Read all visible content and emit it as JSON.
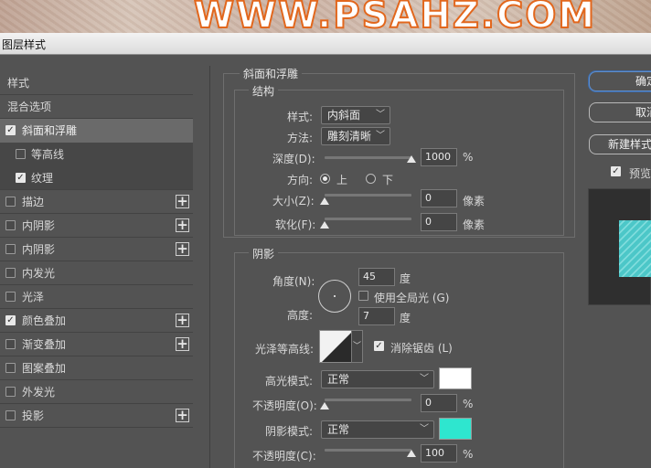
{
  "banner": {
    "text": "WWW.PSAHZ.COM"
  },
  "window": {
    "title": "图层样式"
  },
  "sidebar": {
    "items": [
      {
        "label": "样式"
      },
      {
        "label": "混合选项"
      },
      {
        "label": "斜面和浮雕",
        "checked": true,
        "selected": true
      },
      {
        "label": "等高线",
        "checked": false
      },
      {
        "label": "纹理",
        "checked": true
      },
      {
        "label": "描边",
        "checked": false,
        "plus": true
      },
      {
        "label": "内阴影",
        "checked": false,
        "plus": true
      },
      {
        "label": "内阴影",
        "checked": false,
        "plus": true
      },
      {
        "label": "内发光",
        "checked": false
      },
      {
        "label": "光泽",
        "checked": false
      },
      {
        "label": "颜色叠加",
        "checked": true,
        "plus": true
      },
      {
        "label": "渐变叠加",
        "checked": false,
        "plus": true
      },
      {
        "label": "图案叠加",
        "checked": false
      },
      {
        "label": "外发光",
        "checked": false
      },
      {
        "label": "投影",
        "checked": false,
        "plus": true
      }
    ]
  },
  "bevel": {
    "section_title": "斜面和浮雕",
    "structure_title": "结构",
    "style_label": "样式:",
    "style_value": "内斜面",
    "technique_label": "方法:",
    "technique_value": "雕刻清晰",
    "depth_label": "深度(D):",
    "depth_value": "1000",
    "depth_unit": "%",
    "depth_fraction": 1.0,
    "direction_label": "方向:",
    "direction_up": "上",
    "direction_down": "下",
    "direction_selected": "上",
    "size_label": "大小(Z):",
    "size_value": "0",
    "size_unit": "像素",
    "size_fraction": 0.0,
    "soften_label": "软化(F):",
    "soften_value": "0",
    "soften_unit": "像素",
    "soften_fraction": 0.0
  },
  "shading": {
    "title": "阴影",
    "angle_label": "角度(N):",
    "angle_value": "45",
    "angle_unit": "度",
    "global_light_label": "使用全局光 (G)",
    "global_light_checked": false,
    "altitude_label": "高度:",
    "altitude_value": "7",
    "altitude_unit": "度",
    "gloss_contour_label": "光泽等高线:",
    "antialias_label": "消除锯齿 (L)",
    "antialias_checked": true,
    "highlight_mode_label": "高光模式:",
    "highlight_mode_value": "正常",
    "highlight_color": "#ffffff",
    "highlight_opacity_label": "不透明度(O):",
    "highlight_opacity_value": "0",
    "highlight_opacity_fraction": 0.0,
    "shadow_mode_label": "阴影模式:",
    "shadow_mode_value": "正常",
    "shadow_color": "#2ee6cf",
    "shadow_opacity_label": "不透明度(C):",
    "shadow_opacity_value": "100",
    "shadow_opacity_fraction": 1.0,
    "percent": "%"
  },
  "buttons": {
    "ok": "确定",
    "cancel": "取消",
    "new_style": "新建样式",
    "preview_label": "预览",
    "preview_checked": true
  }
}
